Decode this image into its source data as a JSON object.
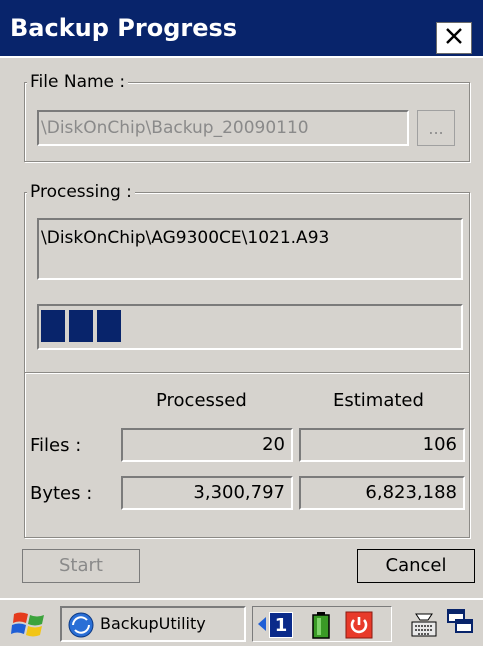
{
  "window": {
    "title": "Backup Progress",
    "close_glyph": "✕"
  },
  "file_group": {
    "label": "File Name :",
    "path_value": "\\DiskOnChip\\Backup_20090110",
    "browse_label": "..."
  },
  "processing_group": {
    "label": "Processing :",
    "current_file": "\\DiskOnChip\\AG9300CE\\1021.A93",
    "progress_blocks": 3,
    "progress_color": "#08246b"
  },
  "stats": {
    "col_processed": "Processed",
    "col_estimated": "Estimated",
    "files_label": "Files :",
    "bytes_label": "Bytes :",
    "files_processed": "20",
    "files_estimated": "106",
    "bytes_processed": "3,300,797",
    "bytes_estimated": "6,823,188"
  },
  "buttons": {
    "start_label": "Start",
    "cancel_label": "Cancel"
  },
  "taskbar": {
    "start_icon": "windows-flag-icon",
    "task_label": "BackupUtility",
    "tray_number": "1",
    "icons": [
      "windows-flag-icon",
      "backup-utility-icon",
      "arrow-left-icon",
      "battery-icon",
      "power-icon",
      "keyboard-icon",
      "windows-switch-icon"
    ]
  },
  "colors": {
    "title_bg": "#08246b",
    "face": "#d6d3ce",
    "disabled_text": "#8a8a8a"
  }
}
